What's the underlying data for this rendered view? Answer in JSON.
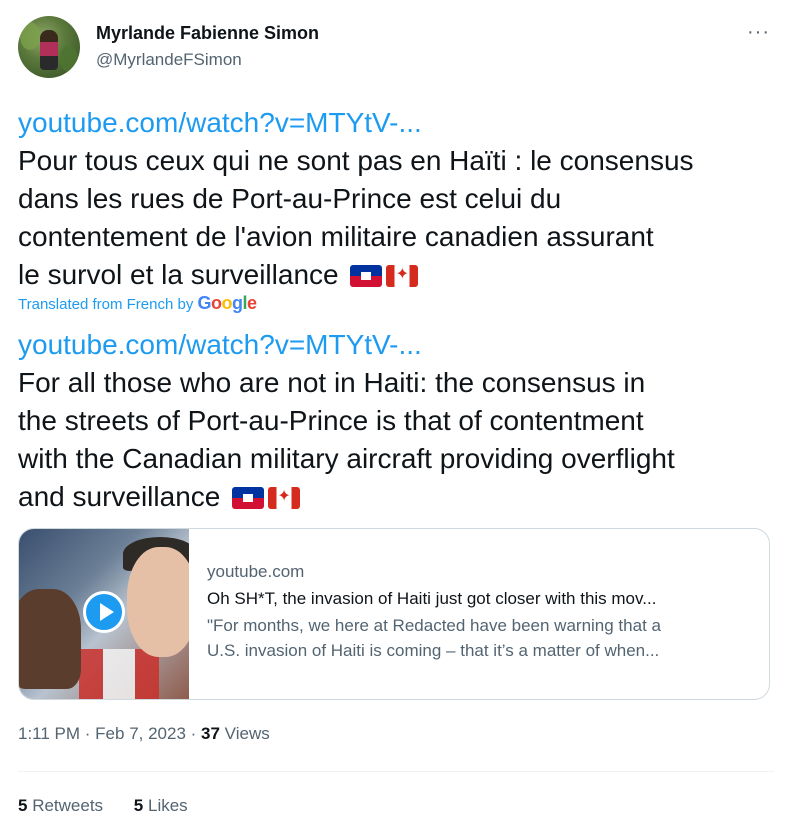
{
  "tweet": {
    "author": {
      "name": "Myrlande Fabienne Simon",
      "handle": "@MyrlandeFSimon"
    },
    "more_label": "···",
    "original": {
      "link": "youtube.com/watch?v=MTYtV-...",
      "lines": [
        "Pour tous ceux qui ne sont pas en Haïti : le consensus",
        "dans les rues de Port-au-Prince est celui du",
        "contentement de l'avion militaire canadien assurant",
        "le survol et la surveillance"
      ]
    },
    "translated_label": "Translated from French by",
    "translator_logo": [
      "G",
      "o",
      "o",
      "g",
      "l",
      "e"
    ],
    "translation": {
      "link": "youtube.com/watch?v=MTYtV-...",
      "lines": [
        "For all those who are not in Haiti: the consensus in",
        "the streets of Port-au-Prince is that of contentment",
        "with the Canadian military aircraft providing overflight",
        "and surveillance"
      ]
    },
    "flags": [
      "flag-haiti-icon",
      "flag-canada-icon"
    ],
    "card": {
      "domain": "youtube.com",
      "title": "Oh SH*T, the invasion of Haiti just got closer with this mov...",
      "description_lines": [
        "\"For months, we here at Redacted have been warning that a",
        "U.S. invasion of Haiti is coming – that it’s a matter of when..."
      ]
    },
    "meta": {
      "time": "1:11 PM",
      "sep1": " · ",
      "date": "Feb 7, 2023",
      "sep2": " · ",
      "views_count": "37",
      "views_label": " Views"
    },
    "stats": {
      "retweets_count": "5",
      "retweets_label": " Retweets",
      "likes_count": "5",
      "likes_label": " Likes"
    }
  },
  "colors": {
    "link": "#1d9bf0",
    "text": "#0f1419",
    "secondary": "#536471",
    "border": "#cfd9de"
  }
}
